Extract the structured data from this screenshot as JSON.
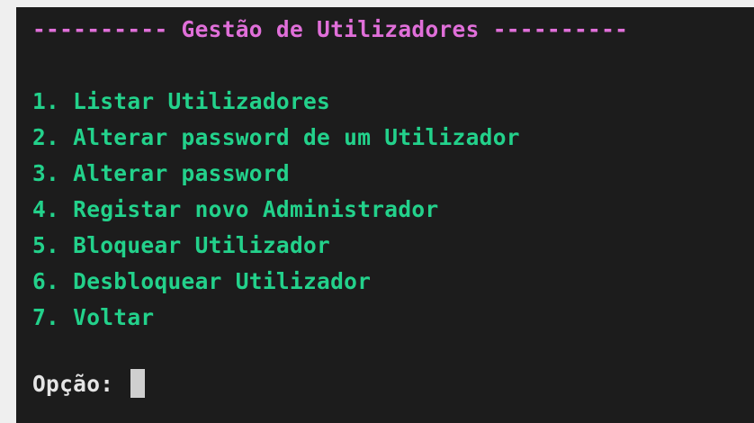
{
  "terminal": {
    "header": "---------- Gestão de Utilizadores ----------",
    "menu_items": [
      "1. Listar Utilizadores",
      "2. Alterar password de um Utilizador",
      "3. Alterar password",
      "4. Registar novo Administrador",
      "5. Bloquear Utilizador",
      "6. Desbloquear Utilizador",
      "7. Voltar"
    ],
    "prompt": "Opção: "
  },
  "colors": {
    "background": "#1c1c1c",
    "header_text": "#e06fd9",
    "menu_text": "#23d18b",
    "prompt_text": "#e5e5e5",
    "cursor": "#cfcfcf"
  }
}
